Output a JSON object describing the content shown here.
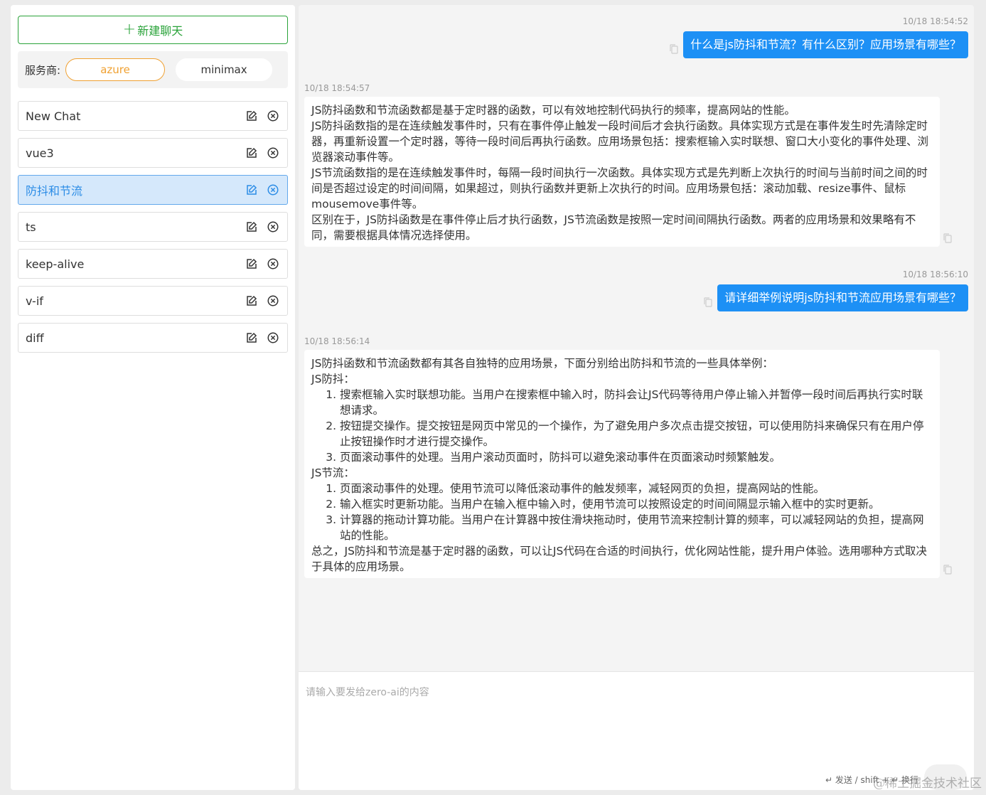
{
  "sidebar": {
    "new_chat_label": "新建聊天",
    "provider_label": "服务商:",
    "providers": [
      {
        "label": "azure",
        "active": true
      },
      {
        "label": "minimax",
        "active": false
      }
    ],
    "chats": [
      {
        "name": "New Chat"
      },
      {
        "name": "vue3"
      },
      {
        "name": "防抖和节流",
        "selected": true
      },
      {
        "name": "ts"
      },
      {
        "name": "keep-alive"
      },
      {
        "name": "v-if"
      },
      {
        "name": "diff"
      }
    ]
  },
  "conversation": {
    "messages": [
      {
        "role": "user",
        "time": "10/18 18:54:52",
        "text": "什么是js防抖和节流？有什么区别？应用场景有哪些？"
      },
      {
        "role": "assistant",
        "time": "10/18 18:54:57",
        "paragraphs": [
          "JS防抖函数和节流函数都是基于定时器的函数，可以有效地控制代码执行的频率，提高网站的性能。",
          "JS防抖函数指的是在连续触发事件时，只有在事件停止触发一段时间后才会执行函数。具体实现方式是在事件发生时先清除定时器，再重新设置一个定时器，等待一段时间后再执行函数。应用场景包括：搜索框输入实时联想、窗口大小变化的事件处理、浏览器滚动事件等。",
          "JS节流函数指的是在连续触发事件时，每隔一段时间执行一次函数。具体实现方式是先判断上次执行的时间与当前时间之间的时间是否超过设定的时间间隔，如果超过，则执行函数并更新上次执行的时间。应用场景包括：滚动加载、resize事件、鼠标mousemove事件等。",
          "区别在于，JS防抖函数是在事件停止后才执行函数，JS节流函数是按照一定时间间隔执行函数。两者的应用场景和效果略有不同，需要根据具体情况选择使用。"
        ]
      },
      {
        "role": "user",
        "time": "10/18 18:56:10",
        "text": "请详细举例说明js防抖和节流应用场景有哪些？"
      },
      {
        "role": "assistant",
        "time": "10/18 18:56:14",
        "intro": "JS防抖函数和节流函数都有其各自独特的应用场景，下面分别给出防抖和节流的一些具体举例：",
        "debounce_title": "JS防抖：",
        "debounce_items": [
          "搜索框输入实时联想功能。当用户在搜索框中输入时，防抖会让JS代码等待用户停止输入并暂停一段时间后再执行实时联想请求。",
          "按钮提交操作。提交按钮是网页中常见的一个操作，为了避免用户多次点击提交按钮，可以使用防抖来确保只有在用户停止按钮操作时才进行提交操作。",
          "页面滚动事件的处理。当用户滚动页面时，防抖可以避免滚动事件在页面滚动时频繁触发。"
        ],
        "throttle_title": "JS节流：",
        "throttle_items": [
          "页面滚动事件的处理。使用节流可以降低滚动事件的触发频率，减轻网页的负担，提高网站的性能。",
          "输入框实时更新功能。当用户在输入框中输入时，使用节流可以按照设定的时间间隔显示输入框中的实时更新。",
          "计算器的拖动计算功能。当用户在计算器中按住滑块拖动时，使用节流来控制计算的频率，可以减轻网站的负担，提高网站的性能。"
        ],
        "conclusion": "总之，JS防抖和节流是基于定时器的函数，可以让JS代码在合适的时间执行，优化网站性能，提升用户体验。选用哪种方式取决于具体的应用场景。"
      }
    ]
  },
  "input": {
    "placeholder": "请输入要发给zero-ai的内容",
    "hint": "↵ 发送 / shift + ↵ 换行"
  },
  "watermark": "@稀土掘金技术社区",
  "colors": {
    "accent": "#1d90f5",
    "new_chat": "#2aa33a",
    "provider_active": "#f0a132"
  }
}
